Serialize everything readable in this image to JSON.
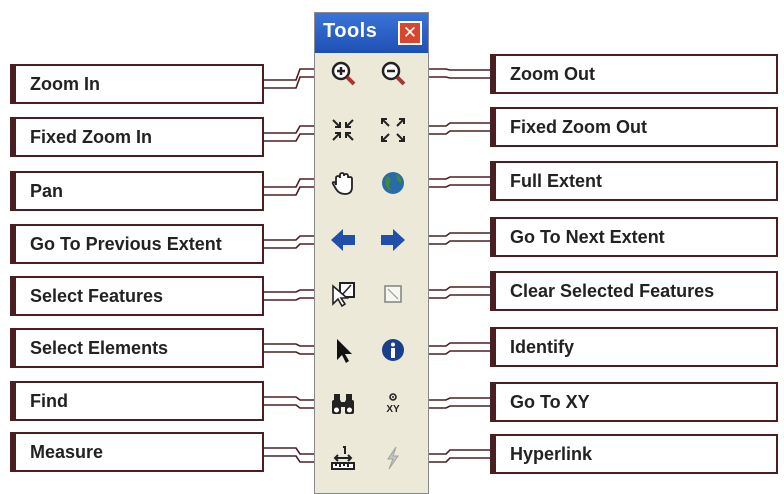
{
  "toolbar": {
    "title": "Tools"
  },
  "left_labels": [
    {
      "text": "Zoom In"
    },
    {
      "text": "Fixed Zoom In"
    },
    {
      "text": "Pan"
    },
    {
      "text": "Go To Previous Extent"
    },
    {
      "text": "Select Features"
    },
    {
      "text": "Select Elements"
    },
    {
      "text": "Find"
    },
    {
      "text": "Measure"
    }
  ],
  "right_labels": [
    {
      "text": "Zoom Out"
    },
    {
      "text": "Fixed Zoom Out"
    },
    {
      "text": "Full Extent"
    },
    {
      "text": "Go To Next Extent"
    },
    {
      "text": "Clear Selected Features"
    },
    {
      "text": "Identify"
    },
    {
      "text": "Go To XY"
    },
    {
      "text": "Hyperlink"
    }
  ],
  "icons": {
    "left": [
      "zoom-in-icon",
      "fixed-zoom-in-icon",
      "pan-hand-icon",
      "back-arrow-icon",
      "select-features-icon",
      "select-pointer-icon",
      "binoculars-icon",
      "measure-icon"
    ],
    "right": [
      "zoom-out-icon",
      "fixed-zoom-out-icon",
      "globe-icon",
      "forward-arrow-icon",
      "clear-selection-icon",
      "info-icon",
      "go-to-xy-icon",
      "hyperlink-icon"
    ]
  },
  "go_to_xy_icon_text": "XY",
  "colors": {
    "title_bar": "#2a5fc4",
    "label_border": "#4b1e22",
    "connector": "#4b1e22",
    "tool_arrow": "#1f4fa8"
  }
}
